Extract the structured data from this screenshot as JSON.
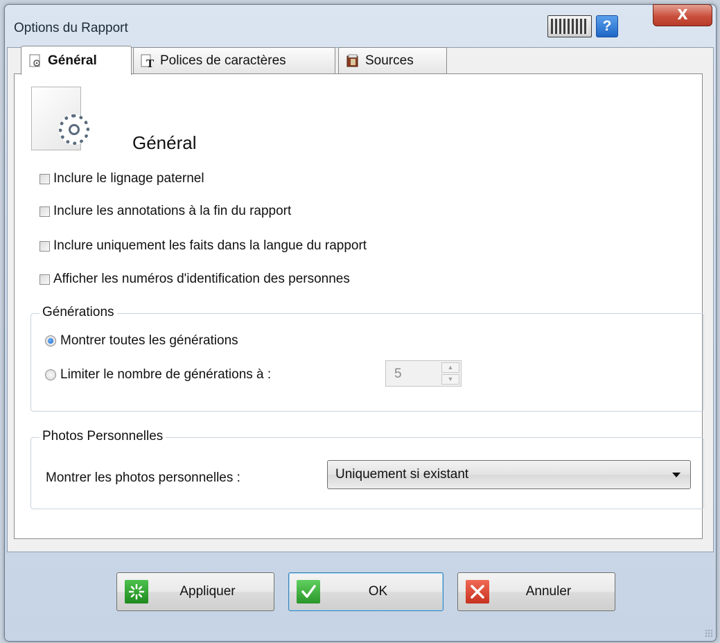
{
  "window": {
    "title": "Options du Rapport",
    "close_label": "X",
    "help_label": "?"
  },
  "tabs": [
    {
      "label": "Général",
      "active": true,
      "icon": "settings-page-icon"
    },
    {
      "label": "Polices de caractères",
      "active": false,
      "icon": "font-icon"
    },
    {
      "label": "Sources",
      "active": false,
      "icon": "book-icon"
    }
  ],
  "general": {
    "heading": "Général",
    "checkboxes": [
      {
        "label": "Inclure le lignage paternel",
        "checked": false
      },
      {
        "label": "Inclure les annotations à la fin du rapport",
        "checked": false
      },
      {
        "label": "Inclure uniquement les faits dans la langue du rapport",
        "checked": false
      },
      {
        "label": "Afficher les numéros d'identification des personnes",
        "checked": false
      }
    ]
  },
  "generations": {
    "legend": "Générations",
    "option_all": "Montrer toutes les générations",
    "option_limit": "Limiter le nombre de générations à :",
    "selected": "all",
    "limit_value": "5"
  },
  "photos": {
    "legend": "Photos Personnelles",
    "label": "Montrer les photos personnelles :",
    "selected": "Uniquement si existant"
  },
  "buttons": {
    "apply": "Appliquer",
    "ok": "OK",
    "cancel": "Annuler"
  },
  "colors": {
    "apply_icon": "#2f9d2f",
    "ok_icon": "#3aa83a",
    "cancel_icon": "#d9412c",
    "selection_accent": "#1560c8"
  }
}
